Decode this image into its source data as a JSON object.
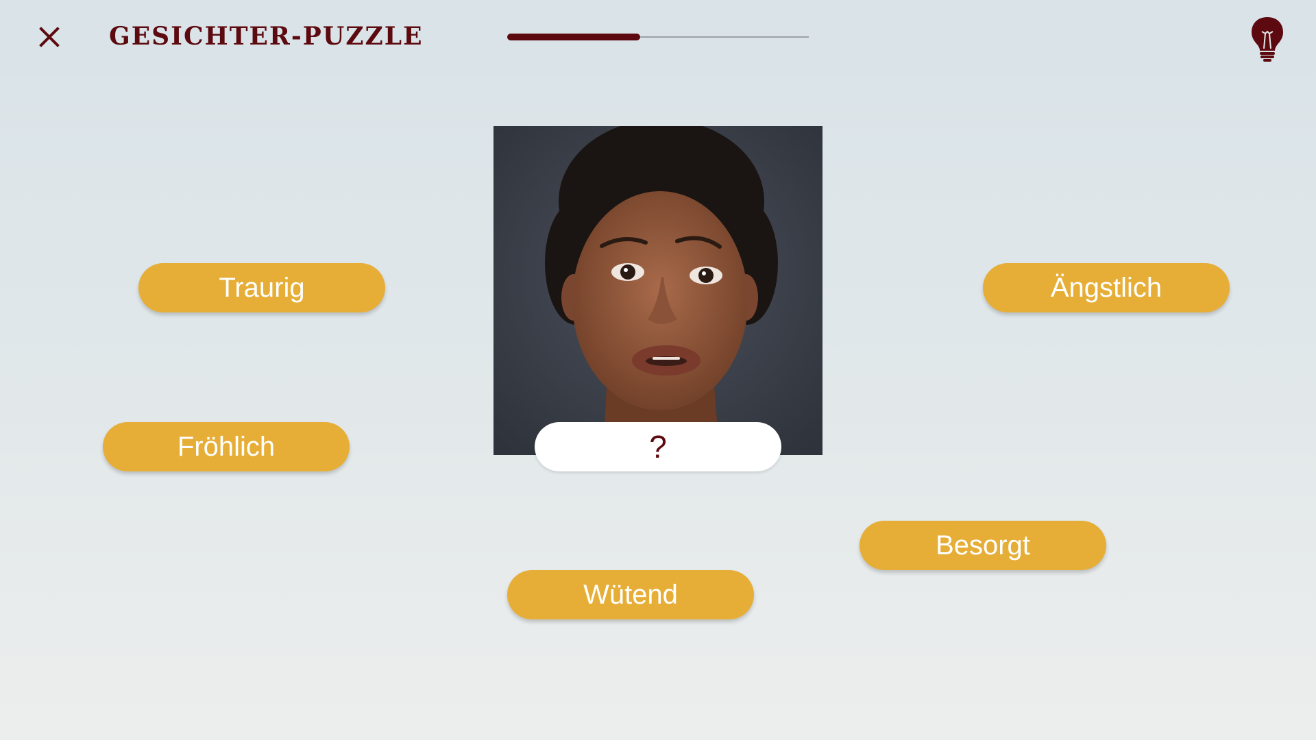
{
  "header": {
    "title": "GESICHTER-PUZZLE",
    "close_icon": "close-icon",
    "hint_icon": "lightbulb-icon",
    "progress": 0.44
  },
  "colors": {
    "accent": "#5c0a0f",
    "chip": "#e6ae36",
    "chip_text": "#ffffff"
  },
  "puzzle": {
    "image": "face-photo",
    "answer_placeholder": "?"
  },
  "choices": [
    {
      "label": "Traurig"
    },
    {
      "label": "Ängstlich"
    },
    {
      "label": "Fröhlich"
    },
    {
      "label": "Besorgt"
    },
    {
      "label": "Wütend"
    }
  ]
}
